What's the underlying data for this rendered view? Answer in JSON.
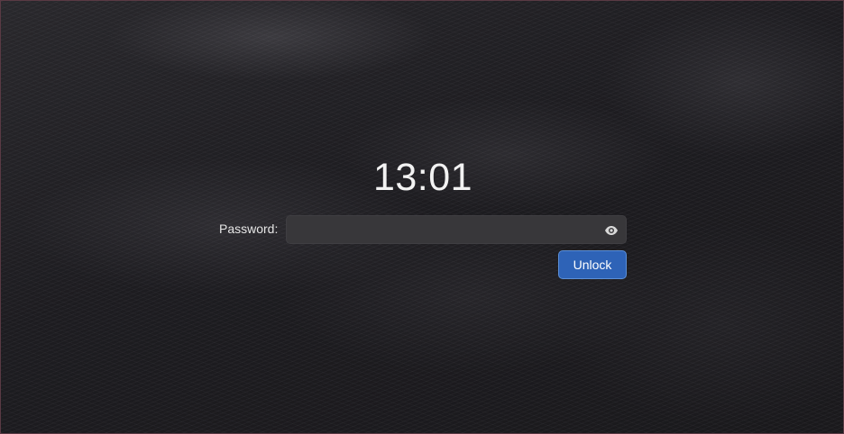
{
  "lock_screen": {
    "clock_time": "13:01",
    "password_label": "Password:",
    "password_value": "",
    "unlock_label": "Unlock",
    "reveal_icon": "eye-icon"
  },
  "colors": {
    "accent": "#2e63b7",
    "background": "#1f1e21",
    "field_background": "#38373a"
  }
}
